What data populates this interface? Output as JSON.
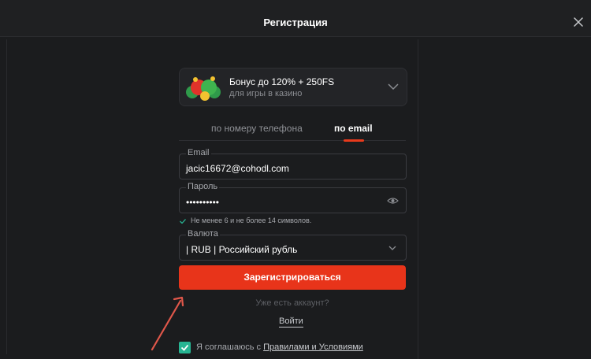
{
  "header": {
    "title": "Регистрация"
  },
  "bonus": {
    "title": "Бонус до 120% + 250FS",
    "subtitle": "для игры в казино"
  },
  "tabs": [
    {
      "label": "по номеру телефона",
      "active": false
    },
    {
      "label": "по email",
      "active": true
    }
  ],
  "form": {
    "email": {
      "label": "Email",
      "value": "jacic16672@cohodl.com"
    },
    "password": {
      "label": "Пароль",
      "value": "••••••••••",
      "hint": "Не менее 6 и не более 14 символов."
    },
    "currency": {
      "label": "Валюта",
      "value": "| RUB | Российский рубль"
    }
  },
  "register_button": "Зарегистрироваться",
  "has_account": "Уже есть аккаунт?",
  "login_link": "Войти",
  "agreement": {
    "text": "Я соглашаюсь с ",
    "link": "Правилами и Условиями",
    "checked": true
  },
  "colors": {
    "accent": "#e8341a",
    "check": "#27b593",
    "background": "#1b1c1e"
  }
}
